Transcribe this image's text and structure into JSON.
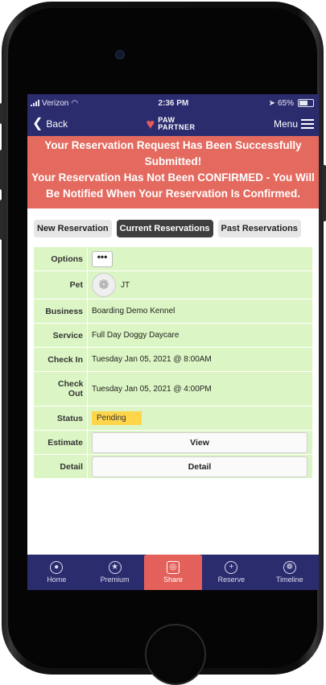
{
  "status_bar": {
    "carrier": "Verizon",
    "time": "2:36 PM",
    "battery": "65%"
  },
  "nav": {
    "back_label": "Back",
    "logo_line1": "PAW",
    "logo_line2": "PARTNER",
    "menu_label": "Menu"
  },
  "banner": {
    "line1": "Your Reservation Request Has Been Successfully Submitted!",
    "line2": "Your Reservation Has Not Been CONFIRMED - You Will Be Notified When Your Reservation Is Confirmed."
  },
  "buttons": {
    "new": "New Reservation",
    "current": "Current Reservations",
    "past": "Past Reservations"
  },
  "details": {
    "options_label": "Options",
    "options_value": "•••",
    "pet_label": "Pet",
    "pet_value": "JT",
    "business_label": "Business",
    "business_value": "Boarding Demo Kennel",
    "service_label": "Service",
    "service_value": "Full Day Doggy Daycare",
    "checkin_label": "Check In",
    "checkin_value": "Tuesday Jan 05, 2021 @ 8:00AM",
    "checkout_label": "Check Out",
    "checkout_value": "Tuesday Jan 05, 2021 @ 4:00PM",
    "status_label": "Status",
    "status_value": "Pending",
    "estimate_label": "Estimate",
    "estimate_button": "View",
    "detail_label": "Detail",
    "detail_button": "Detail"
  },
  "tabbar": [
    {
      "label": "Home",
      "icon": "person-icon"
    },
    {
      "label": "Premium",
      "icon": "star-icon"
    },
    {
      "label": "Share",
      "icon": "camera-icon"
    },
    {
      "label": "Reserve",
      "icon": "plus-icon"
    },
    {
      "label": "Timeline",
      "icon": "paw-icon"
    }
  ],
  "colors": {
    "navy": "#2b2c6e",
    "banner_red": "#e46a5f",
    "details_green": "#dcf5c4",
    "pending_yellow": "#ffd54a"
  }
}
